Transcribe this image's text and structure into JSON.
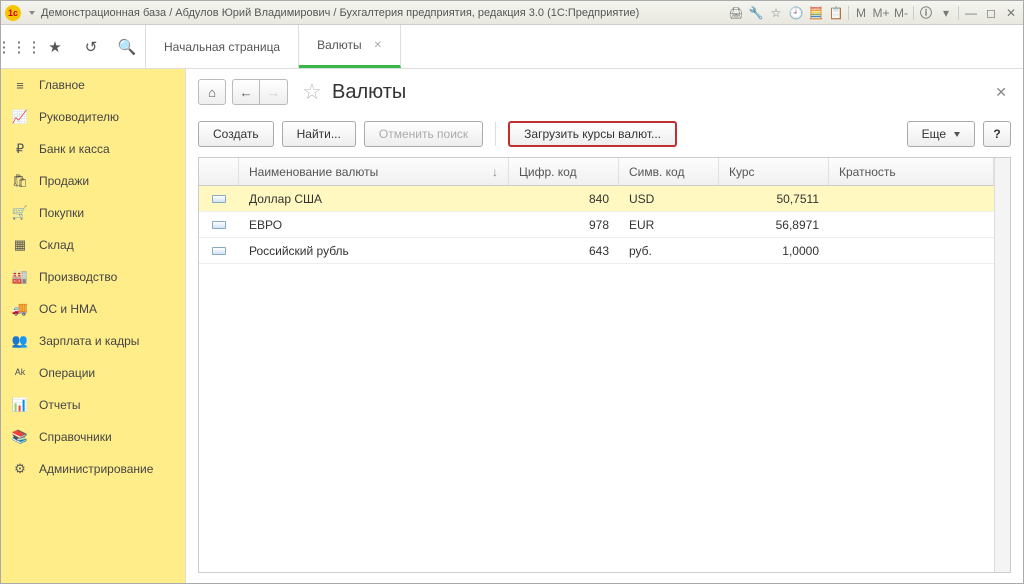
{
  "titlebar": {
    "text": "Демонстрационная база / Абдулов Юрий Владимирович / Бухгалтерия предприятия, редакция 3.0  (1С:Предприятие)",
    "m_buttons": [
      "M",
      "M+",
      "M-"
    ]
  },
  "tabs": {
    "items": [
      {
        "label": "Начальная страница",
        "active": false
      },
      {
        "label": "Валюты",
        "active": true
      }
    ]
  },
  "sidebar": {
    "items": [
      {
        "icon": "≡",
        "label": "Главное"
      },
      {
        "icon": "📈",
        "label": "Руководителю"
      },
      {
        "icon": "₽",
        "label": "Банк и касса"
      },
      {
        "icon": "🛍",
        "label": "Продажи"
      },
      {
        "icon": "🛒",
        "label": "Покупки"
      },
      {
        "icon": "▦",
        "label": "Склад"
      },
      {
        "icon": "🏭",
        "label": "Производство"
      },
      {
        "icon": "🚚",
        "label": "ОС и НМА"
      },
      {
        "icon": "👥",
        "label": "Зарплата и кадры"
      },
      {
        "icon": "ᴰᴷ",
        "label": "Операции"
      },
      {
        "icon": "📊",
        "label": "Отчеты"
      },
      {
        "icon": "📚",
        "label": "Справочники"
      },
      {
        "icon": "⚙",
        "label": "Администрирование"
      }
    ]
  },
  "page": {
    "title": "Валюты"
  },
  "toolbar": {
    "create": "Создать",
    "find": "Найти...",
    "cancel_find": "Отменить поиск",
    "load_rates": "Загрузить курсы валют...",
    "more": "Еще",
    "help": "?"
  },
  "grid": {
    "columns": {
      "name": "Наименование валюты",
      "code": "Цифр. код",
      "sym": "Симв. код",
      "rate": "Курс",
      "mult": "Кратность"
    },
    "rows": [
      {
        "name": "Доллар США",
        "code": "840",
        "sym": "USD",
        "rate": "50,7511",
        "mult": "",
        "selected": true
      },
      {
        "name": "ЕВРО",
        "code": "978",
        "sym": "EUR",
        "rate": "56,8971",
        "mult": "",
        "selected": false
      },
      {
        "name": "Российский рубль",
        "code": "643",
        "sym": "руб.",
        "rate": "1,0000",
        "mult": "",
        "selected": false
      }
    ]
  }
}
